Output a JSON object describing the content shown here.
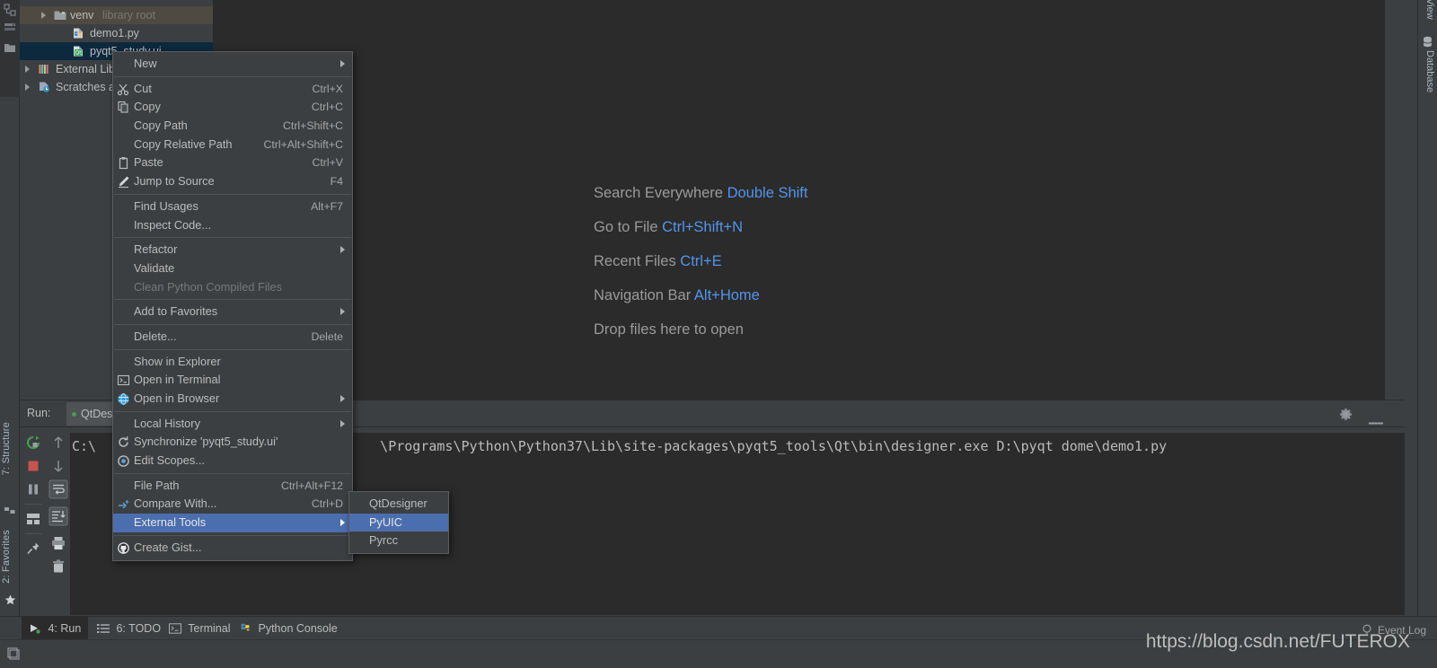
{
  "project_tree": {
    "rows": [
      {
        "label": "",
        "sub": "",
        "icon": "partial-row",
        "indent": 0,
        "state": "cut"
      },
      {
        "label": "venv",
        "sub": "library root",
        "icon": "folder-icon",
        "indent": 2,
        "state": "selected-grey",
        "arrow": true
      },
      {
        "label": "demo1.py",
        "sub": "",
        "icon": "python-file-icon",
        "indent": 3,
        "state": "normal",
        "arrow": false
      },
      {
        "label": "pyqt5_study.ui",
        "sub": "",
        "icon": "qt-ui-file-icon",
        "indent": 3,
        "state": "selected-blue",
        "arrow": false
      },
      {
        "label": "External Lib",
        "sub": "",
        "icon": "library-icon",
        "indent": 1,
        "state": "normal",
        "arrow": true
      },
      {
        "label": "Scratches a",
        "sub": "",
        "icon": "scratches-icon",
        "indent": 1,
        "state": "normal",
        "arrow": true
      }
    ]
  },
  "left_strip": {
    "tabs": [
      {
        "label": "7: Structure",
        "icon": "structure-icon"
      },
      {
        "label": "2: Favorites",
        "icon": "star-icon"
      }
    ]
  },
  "right_strip": {
    "tabs": [
      {
        "label": "View",
        "icon": ""
      },
      {
        "label": "Database",
        "icon": "database-icon"
      }
    ]
  },
  "editor_tips": [
    {
      "action": "Search Everywhere",
      "shortcut": "Double Shift"
    },
    {
      "action": "Go to File",
      "shortcut": "Ctrl+Shift+N"
    },
    {
      "action": "Recent Files",
      "shortcut": "Ctrl+E"
    },
    {
      "action": "Navigation Bar",
      "shortcut": "Alt+Home"
    },
    {
      "action": "Drop files here to open",
      "shortcut": ""
    }
  ],
  "context_menu": {
    "items": [
      {
        "label": "New",
        "mnemonic": "",
        "shortcut": "",
        "submenu": true,
        "icon": "",
        "state": "normal"
      },
      {
        "sep": true
      },
      {
        "label": "Cut",
        "mnemonic": "t",
        "shortcut": "Ctrl+X",
        "submenu": false,
        "icon": "scissors-icon",
        "state": "normal"
      },
      {
        "label": "Copy",
        "mnemonic": "C",
        "shortcut": "Ctrl+C",
        "submenu": false,
        "icon": "copy-icon",
        "state": "normal"
      },
      {
        "label": "Copy Path",
        "mnemonic": "o",
        "shortcut": "Ctrl+Shift+C",
        "submenu": false,
        "icon": "",
        "state": "normal"
      },
      {
        "label": "Copy Relative Path",
        "mnemonic": "y",
        "shortcut": "Ctrl+Alt+Shift+C",
        "submenu": false,
        "icon": "",
        "state": "normal"
      },
      {
        "label": "Paste",
        "mnemonic": "P",
        "shortcut": "Ctrl+V",
        "submenu": false,
        "icon": "clipboard-icon",
        "state": "normal"
      },
      {
        "label": "Jump to Source",
        "mnemonic": "",
        "shortcut": "F4",
        "submenu": false,
        "icon": "pencil-icon",
        "state": "normal"
      },
      {
        "sep": true
      },
      {
        "label": "Find Usages",
        "mnemonic": "U",
        "shortcut": "Alt+F7",
        "submenu": false,
        "icon": "",
        "state": "normal"
      },
      {
        "label": "Inspect Code...",
        "mnemonic": "I",
        "shortcut": "",
        "submenu": false,
        "icon": "",
        "state": "normal"
      },
      {
        "sep": true
      },
      {
        "label": "Refactor",
        "mnemonic": "R",
        "shortcut": "",
        "submenu": true,
        "icon": "",
        "state": "normal"
      },
      {
        "label": "Validate",
        "mnemonic": "V",
        "shortcut": "",
        "submenu": false,
        "icon": "",
        "state": "normal"
      },
      {
        "label": "Clean Python Compiled Files",
        "mnemonic": "",
        "shortcut": "",
        "submenu": false,
        "icon": "",
        "state": "disabled"
      },
      {
        "sep": true
      },
      {
        "label": "Add to Favorites",
        "mnemonic": "F",
        "shortcut": "",
        "submenu": true,
        "icon": "",
        "state": "normal"
      },
      {
        "sep": true
      },
      {
        "label": "Delete...",
        "mnemonic": "D",
        "shortcut": "Delete",
        "submenu": false,
        "icon": "",
        "state": "normal"
      },
      {
        "sep": true
      },
      {
        "label": "Show in Explorer",
        "mnemonic": "",
        "shortcut": "",
        "submenu": false,
        "icon": "",
        "state": "normal"
      },
      {
        "label": "Open in Terminal",
        "mnemonic": "",
        "shortcut": "",
        "submenu": false,
        "icon": "terminal-icon",
        "state": "normal"
      },
      {
        "label": "Open in Browser",
        "mnemonic": "B",
        "shortcut": "",
        "submenu": true,
        "icon": "globe-icon",
        "state": "normal"
      },
      {
        "sep": true
      },
      {
        "label": "Local History",
        "mnemonic": "H",
        "shortcut": "",
        "submenu": true,
        "icon": "",
        "state": "normal"
      },
      {
        "label": "Synchronize 'pyqt5_study.ui'",
        "mnemonic": "",
        "shortcut": "",
        "submenu": false,
        "icon": "refresh-icon",
        "state": "normal"
      },
      {
        "label": "Edit Scopes...",
        "mnemonic": "i",
        "shortcut": "",
        "submenu": false,
        "icon": "scopes-icon",
        "state": "normal"
      },
      {
        "sep": true
      },
      {
        "label": "File Path",
        "mnemonic": "P",
        "shortcut": "Ctrl+Alt+F12",
        "submenu": false,
        "icon": "",
        "state": "normal"
      },
      {
        "label": "Compare With...",
        "mnemonic": "",
        "shortcut": "Ctrl+D",
        "submenu": false,
        "icon": "compare-icon",
        "state": "normal"
      },
      {
        "label": "External Tools",
        "mnemonic": "",
        "shortcut": "",
        "submenu": true,
        "icon": "",
        "state": "highlighted"
      },
      {
        "label": "Create Gist...",
        "mnemonic": "",
        "shortcut": "",
        "submenu": false,
        "icon": "github-icon",
        "state": "normal"
      }
    ]
  },
  "external_tools_submenu": {
    "items": [
      {
        "label": "QtDesigner",
        "state": "normal"
      },
      {
        "label": "PyUIC",
        "state": "highlighted"
      },
      {
        "label": "Pyrcc",
        "state": "normal"
      }
    ]
  },
  "run_window": {
    "label": "Run:",
    "tab_label": "QtDes",
    "console_text": "C:\\                                   \\Programs\\Python\\Python37\\Lib\\site-packages\\pyqt5_tools\\Qt\\bin\\designer.exe D:\\pyqt dome\\demo1.py",
    "console_prefix": "C:\\",
    "console_path": "\\Programs\\Python\\Python37\\Lib\\site-packages\\pyqt5_tools\\Qt\\bin\\designer.exe D:\\pyqt dome\\demo1.py",
    "header_buttons": [
      {
        "name": "settings",
        "icon": "gear-icon"
      },
      {
        "name": "hide",
        "icon": "minimize-icon"
      }
    ],
    "toolbar_buttons": [
      {
        "icon": "rerun-icon",
        "name": "rerun"
      },
      {
        "icon": "stop-icon",
        "name": "stop"
      },
      {
        "icon": "pause-icon",
        "name": "pause"
      },
      {
        "icon": "grid-icon",
        "name": "layout"
      },
      {
        "icon": "pin-icon",
        "name": "pin"
      },
      {
        "icon": "up-arrow-icon",
        "name": "prev-occurrence"
      },
      {
        "icon": "down-arrow-icon",
        "name": "next-occurrence"
      },
      {
        "icon": "soft-wrap-icon",
        "name": "soft-wrap"
      },
      {
        "icon": "scroll-end-icon",
        "name": "scroll-to-end"
      },
      {
        "icon": "print-icon",
        "name": "print"
      },
      {
        "icon": "trash-icon",
        "name": "clear-all"
      }
    ]
  },
  "bottom_bar": {
    "buttons": [
      {
        "label": "4: Run",
        "mnemonic": "4",
        "icon": "run-icon",
        "active": true
      },
      {
        "label": "6: TODO",
        "mnemonic": "6",
        "icon": "todo-icon",
        "active": false
      },
      {
        "label": "Terminal",
        "mnemonic": "",
        "icon": "terminal-icon",
        "active": false
      },
      {
        "label": "Python Console",
        "mnemonic": "",
        "icon": "python-icon",
        "active": false
      }
    ]
  },
  "status_bar": {
    "event_log": "Event Log",
    "watermark": "https://blog.csdn.net/FUTEROX"
  },
  "colors": {
    "bg_panel": "#3c3f41",
    "bg_editor": "#2b2b2b",
    "accent_blue": "#4b6eaf",
    "link_blue": "#5394ec",
    "text": "#bbbbbb",
    "text_dim": "#787878",
    "selection_grey": "#4e4a41",
    "selection_blue": "#0d293e",
    "green": "#499c54",
    "red": "#c75450"
  }
}
